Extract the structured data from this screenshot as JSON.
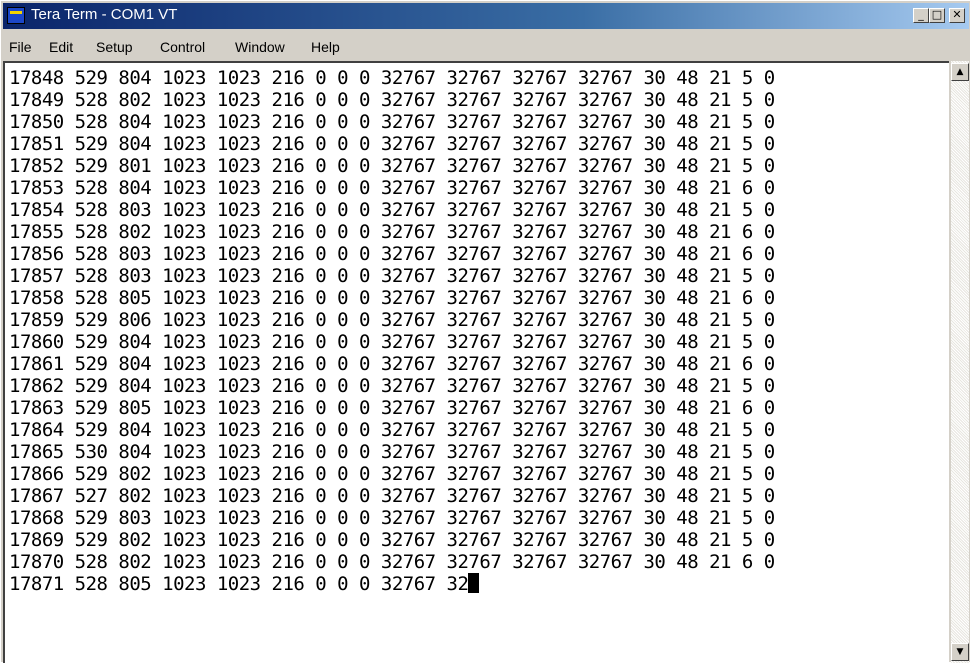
{
  "window": {
    "title": "Tera Term - COM1 VT",
    "minimize_glyph": "_",
    "maximize_glyph": "□",
    "close_glyph": "✕",
    "icon": "teraterm-app-icon"
  },
  "menubar": {
    "items": [
      "File",
      "Edit",
      "Setup",
      "Control",
      "Window",
      "Help"
    ]
  },
  "terminal": {
    "lines": [
      "17848 529 804 1023 1023 216 0 0 0 32767 32767 32767 32767 30 48 21 5 0",
      "17849 528 802 1023 1023 216 0 0 0 32767 32767 32767 32767 30 48 21 5 0",
      "17850 528 804 1023 1023 216 0 0 0 32767 32767 32767 32767 30 48 21 5 0",
      "17851 529 804 1023 1023 216 0 0 0 32767 32767 32767 32767 30 48 21 5 0",
      "17852 529 801 1023 1023 216 0 0 0 32767 32767 32767 32767 30 48 21 5 0",
      "17853 528 804 1023 1023 216 0 0 0 32767 32767 32767 32767 30 48 21 6 0",
      "17854 528 803 1023 1023 216 0 0 0 32767 32767 32767 32767 30 48 21 5 0",
      "17855 528 802 1023 1023 216 0 0 0 32767 32767 32767 32767 30 48 21 6 0",
      "17856 528 803 1023 1023 216 0 0 0 32767 32767 32767 32767 30 48 21 6 0",
      "17857 528 803 1023 1023 216 0 0 0 32767 32767 32767 32767 30 48 21 5 0",
      "17858 528 805 1023 1023 216 0 0 0 32767 32767 32767 32767 30 48 21 6 0",
      "17859 529 806 1023 1023 216 0 0 0 32767 32767 32767 32767 30 48 21 5 0",
      "17860 529 804 1023 1023 216 0 0 0 32767 32767 32767 32767 30 48 21 5 0",
      "17861 529 804 1023 1023 216 0 0 0 32767 32767 32767 32767 30 48 21 6 0",
      "17862 529 804 1023 1023 216 0 0 0 32767 32767 32767 32767 30 48 21 5 0",
      "17863 529 805 1023 1023 216 0 0 0 32767 32767 32767 32767 30 48 21 6 0",
      "17864 529 804 1023 1023 216 0 0 0 32767 32767 32767 32767 30 48 21 5 0",
      "17865 530 804 1023 1023 216 0 0 0 32767 32767 32767 32767 30 48 21 5 0",
      "17866 529 802 1023 1023 216 0 0 0 32767 32767 32767 32767 30 48 21 5 0",
      "17867 527 802 1023 1023 216 0 0 0 32767 32767 32767 32767 30 48 21 5 0",
      "17868 529 803 1023 1023 216 0 0 0 32767 32767 32767 32767 30 48 21 5 0",
      "17869 529 802 1023 1023 216 0 0 0 32767 32767 32767 32767 30 48 21 5 0",
      "17870 528 802 1023 1023 216 0 0 0 32767 32767 32767 32767 30 48 21 6 0"
    ],
    "current_line": "17871 528 805 1023 1023 216 0 0 0 32767 32"
  },
  "scrollbar": {
    "up_glyph": "▲",
    "down_glyph": "▼"
  }
}
